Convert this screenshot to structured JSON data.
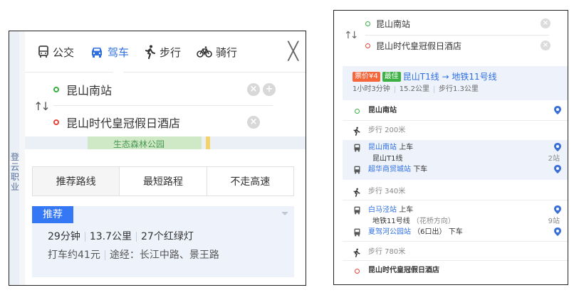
{
  "left": {
    "map": {
      "park_label": "生态森林公园",
      "city_label": "登云职业"
    },
    "tabs": [
      {
        "label": "公交",
        "icon": "bus-icon",
        "active": false
      },
      {
        "label": "驾车",
        "icon": "car-icon",
        "active": true
      },
      {
        "label": "步行",
        "icon": "walk-icon",
        "active": false
      },
      {
        "label": "骑行",
        "icon": "bike-icon",
        "active": false
      }
    ],
    "close_label": "╳",
    "start": "昆山南站",
    "end": "昆山时代皇冠假日酒店",
    "swap_glyph": "↑↓",
    "strategy_tabs": [
      "推荐路线",
      "最短路程",
      "不走高速"
    ],
    "recommend": {
      "badge": "推荐",
      "time": "29分钟",
      "distance": "13.7公里",
      "lights": "27个红绿灯",
      "taxi": "打车约41元",
      "via": "途经：长江中路、景王路"
    }
  },
  "right": {
    "start": "昆山南站",
    "end": "昆山时代皇冠假日酒店",
    "swap_glyph": "↑↓",
    "header": {
      "fare_tag": "票价¥4",
      "best_tag": "最佳",
      "title": "昆山T1线 → 地铁11号线",
      "duration": "1小时3分钟",
      "distance": "15.2公里",
      "walk": "步行1.3公里"
    },
    "steps": {
      "start_name": "昆山南站",
      "walk1": "步行 200米",
      "board1_station": "昆山南站",
      "board1_action": "上车",
      "line1": "昆山T1线",
      "line1_stops": "2站",
      "alight1_station": "超华商贸城站",
      "alight1_action": "下车",
      "walk2": "步行 340米",
      "board2_station": "白马泾站",
      "board2_action": "上车",
      "line2": "地铁11号线",
      "line2_dir": "（花桥方向）",
      "line2_stops": "9站",
      "alight2_station": "夏驾河公园站",
      "alight2_exit": "（6口出）",
      "alight2_action": "下车",
      "walk3": "步行 780米",
      "end_name": "昆山时代皇冠假日酒店"
    }
  },
  "colors": {
    "accent": "#2f6fe0",
    "start_dot": "#3cb043",
    "end_dot": "#e8443a",
    "fare_tag": "#f5663b",
    "best_tag": "#3cb043"
  }
}
